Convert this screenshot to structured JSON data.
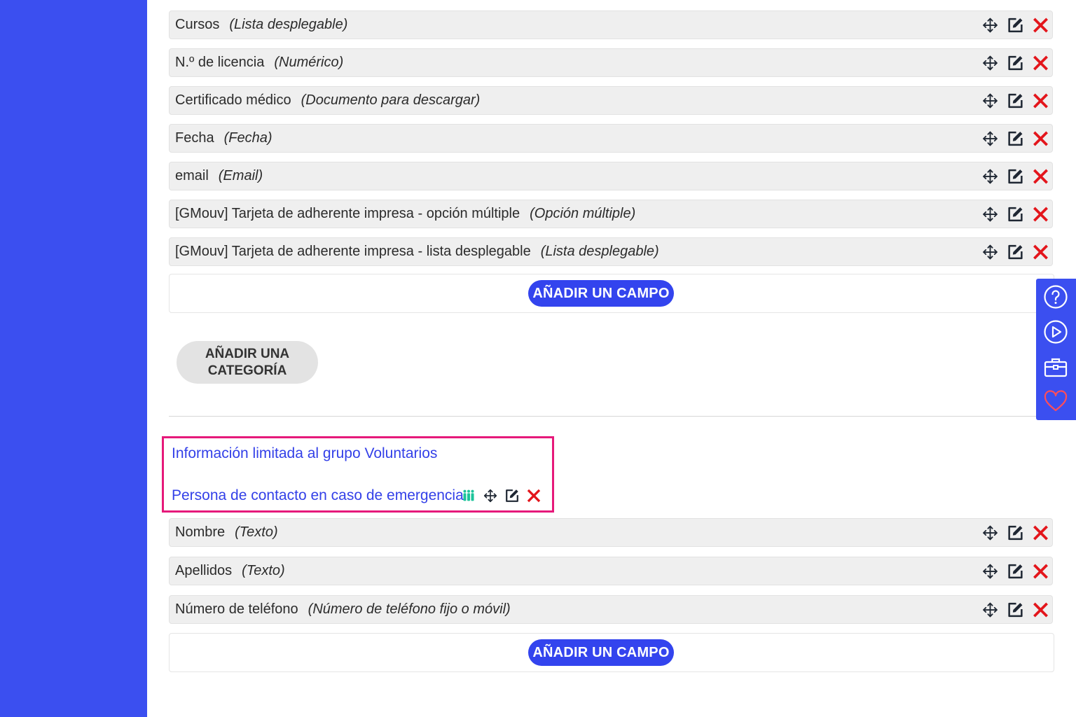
{
  "section1": {
    "fields": [
      {
        "name": "Cursos",
        "type": "(Lista desplegable)"
      },
      {
        "name": "N.º de licencia",
        "type": "(Numérico)"
      },
      {
        "name": "Certificado médico",
        "type": "(Documento para descargar)"
      },
      {
        "name": "Fecha",
        "type": "(Fecha)"
      },
      {
        "name": "email",
        "type": "(Email)"
      },
      {
        "name": "[GMouv] Tarjeta de adherente impresa - opción múltiple",
        "type": "(Opción múltiple)"
      },
      {
        "name": "[GMouv] Tarjeta de adherente impresa - lista desplegable",
        "type": "(Lista desplegable)"
      }
    ],
    "add_field_label": "AÑADIR UN CAMPO"
  },
  "add_category_label": "AÑADIR UNA CATEGORÍA",
  "section2": {
    "restricted_note": "Información limitada al grupo Voluntarios",
    "category_title": "Persona de contacto en caso de emergencia",
    "fields": [
      {
        "name": "Nombre",
        "type": "(Texto)"
      },
      {
        "name": "Apellidos",
        "type": "(Texto)"
      },
      {
        "name": "Número de teléfono",
        "type": "(Número de teléfono fijo o móvil)"
      }
    ],
    "add_field_label": "AÑADIR UN CAMPO"
  },
  "icons": {
    "row_actions": [
      "move-icon",
      "edit-icon",
      "delete-icon"
    ],
    "category_actions": [
      "group-icon",
      "move-icon",
      "edit-icon",
      "delete-icon"
    ],
    "side_panel": [
      "help-icon",
      "play-icon",
      "toolbox-icon",
      "heart-icon"
    ]
  },
  "colors": {
    "sidebar": "#3b4ff0",
    "accent_button": "#3344ee",
    "link_text": "#3340e8",
    "delete": "#e3151b",
    "group_icon": "#1cc49a",
    "highlight_border": "#e6197a",
    "heart": "#ff4d5a"
  }
}
